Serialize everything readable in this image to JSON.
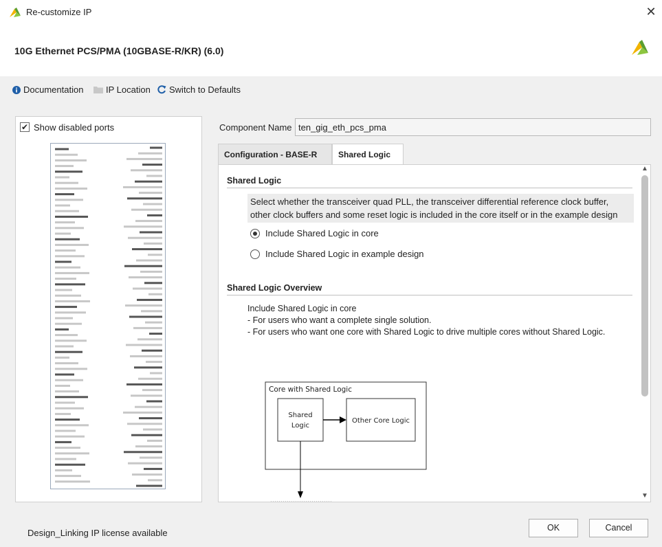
{
  "window": {
    "title": "Re-customize IP",
    "close_glyph": "✕"
  },
  "header": {
    "heading": "10G Ethernet PCS/PMA (10GBASE-R/KR) (6.0)"
  },
  "links": {
    "documentation": "Documentation",
    "ip_location": "IP Location",
    "switch_defaults": "Switch to Defaults"
  },
  "left": {
    "show_disabled_ports": "Show disabled ports"
  },
  "component": {
    "label": "Component Name",
    "value": "ten_gig_eth_pcs_pma"
  },
  "tabs": [
    {
      "label": "Configuration - BASE-R"
    },
    {
      "label": "Shared Logic"
    }
  ],
  "shared_logic": {
    "title": "Shared Logic",
    "description": "Select whether the transceiver quad PLL, the transceiver differential reference clock buffer, other clock buffers and some reset logic is included in the core itself or in the example design",
    "options": [
      {
        "label": "Include Shared Logic in core",
        "selected": true
      },
      {
        "label": "Include Shared Logic in example design",
        "selected": false
      }
    ]
  },
  "overview": {
    "title": "Shared Logic Overview",
    "lines": [
      "Include Shared Logic in core",
      "- For users who want a complete single solution.",
      "- For users who want one core with Shared Logic to drive multiple cores without Shared Logic."
    ],
    "diagram": {
      "outer_label": "Core with Shared Logic",
      "shared_line1": "Shared",
      "shared_line2": "Logic",
      "other": "Other Core Logic"
    }
  },
  "footer": {
    "license": "Design_Linking IP license available",
    "ok": "OK",
    "cancel": "Cancel"
  },
  "colors": {
    "brand_yellow": "#f2b400",
    "brand_green": "#5a9e2f",
    "info_blue": "#1f5fa8"
  }
}
